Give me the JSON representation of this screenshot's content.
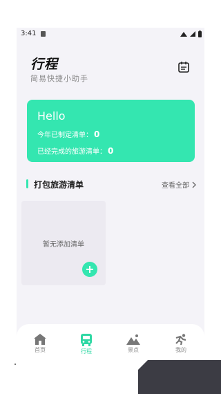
{
  "status": {
    "time": "3:41"
  },
  "header": {
    "title": "行程",
    "subtitle": "简易快捷小助手"
  },
  "summary": {
    "greeting": "Hello",
    "made_label": "今年已制定清单：",
    "made_count": "0",
    "done_label": "已经完成的旅游清单：",
    "done_count": "0"
  },
  "section": {
    "title": "打包旅游清单",
    "see_all": "查看全部"
  },
  "empty": {
    "text": "暂无添加清单"
  },
  "tabs": [
    {
      "label": "首页",
      "icon": "home-icon"
    },
    {
      "label": "行程",
      "icon": "bus-icon"
    },
    {
      "label": "景点",
      "icon": "mountain-icon"
    },
    {
      "label": "我的",
      "icon": "runner-icon"
    }
  ],
  "colors": {
    "accent": "#34e6b0",
    "background": "#f4f3f8"
  }
}
